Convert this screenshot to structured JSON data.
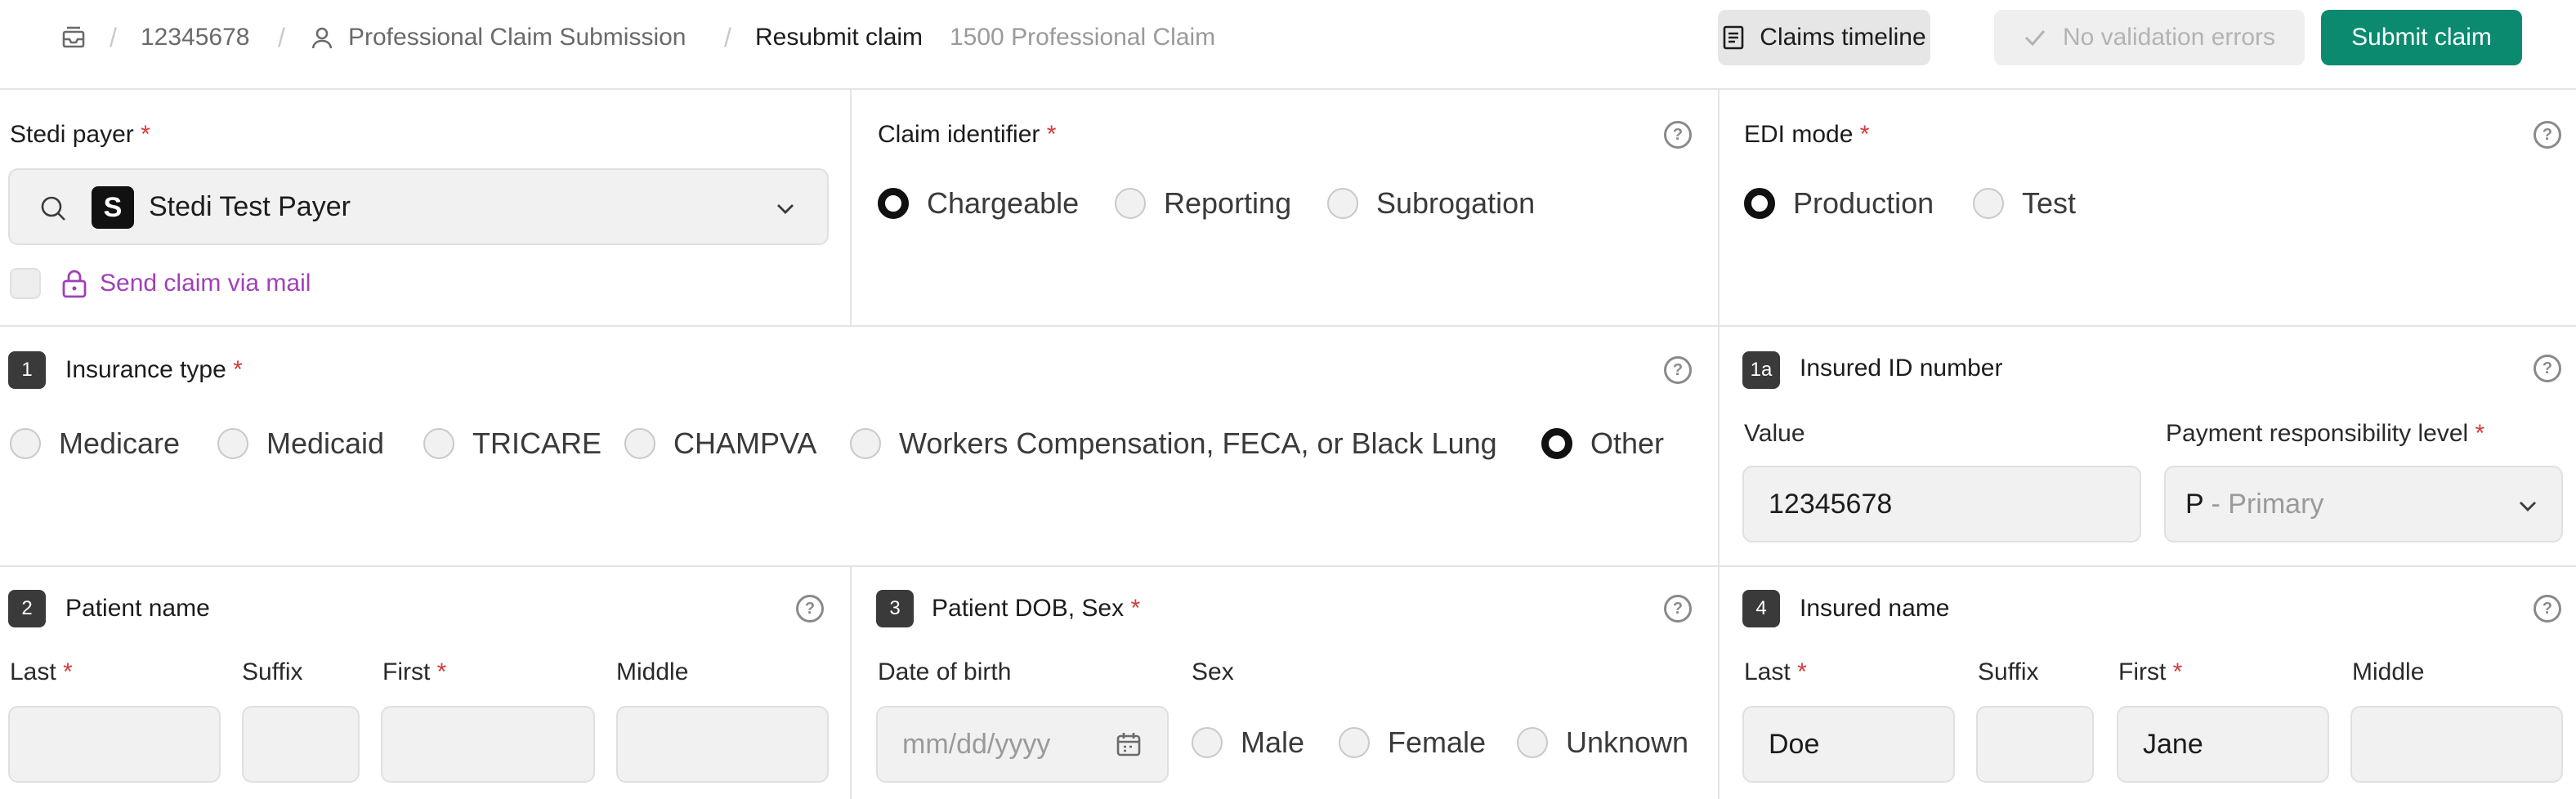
{
  "topbar": {
    "claim_number": "12345678",
    "crumb_form": "Professional Claim Submission",
    "crumb_current": "Resubmit claim",
    "crumb_subtitle": "1500 Professional Claim",
    "timeline_button": "Claims timeline",
    "validation_button": "No validation errors",
    "submit_button": "Submit claim"
  },
  "payer": {
    "label": "Stedi payer",
    "value": "Stedi Test Payer",
    "logo_letter": "S",
    "mail_label": "Send claim via mail"
  },
  "claim_identifier": {
    "label": "Claim identifier",
    "options": [
      "Chargeable",
      "Reporting",
      "Subrogation"
    ],
    "selected": "Chargeable"
  },
  "edi_mode": {
    "label": "EDI mode",
    "options": [
      "Production",
      "Test"
    ],
    "selected": "Production"
  },
  "insurance_type": {
    "number": "1",
    "label": "Insurance type",
    "options": [
      "Medicare",
      "Medicaid",
      "TRICARE",
      "CHAMPVA",
      "Workers Compensation, FECA, or Black Lung",
      "Other"
    ],
    "selected": "Other"
  },
  "insured_id": {
    "number": "1a",
    "label": "Insured ID number",
    "value_label": "Value",
    "value": "12345678",
    "responsibility_label": "Payment responsibility level",
    "responsibility_code": "P",
    "responsibility_text": "- Primary"
  },
  "patient_name": {
    "number": "2",
    "label": "Patient name",
    "last_label": "Last",
    "suffix_label": "Suffix",
    "first_label": "First",
    "middle_label": "Middle"
  },
  "patient_dob_sex": {
    "number": "3",
    "label": "Patient DOB, Sex",
    "dob_label": "Date of birth",
    "dob_placeholder": "mm/dd/yyyy",
    "sex_label": "Sex",
    "sex_options": [
      "Male",
      "Female",
      "Unknown"
    ]
  },
  "insured_name": {
    "number": "4",
    "label": "Insured name",
    "last_label": "Last",
    "suffix_label": "Suffix",
    "first_label": "First",
    "middle_label": "Middle",
    "last_value": "Doe",
    "first_value": "Jane"
  },
  "colors": {
    "accent": "#0b8a6f",
    "required": "#d63a3a",
    "link": "#a040b8"
  },
  "icons": [
    "inbox-icon",
    "user-icon",
    "list-icon",
    "check-icon",
    "search-icon",
    "chevron-down-icon",
    "lock-icon",
    "help-icon",
    "calendar-icon"
  ]
}
